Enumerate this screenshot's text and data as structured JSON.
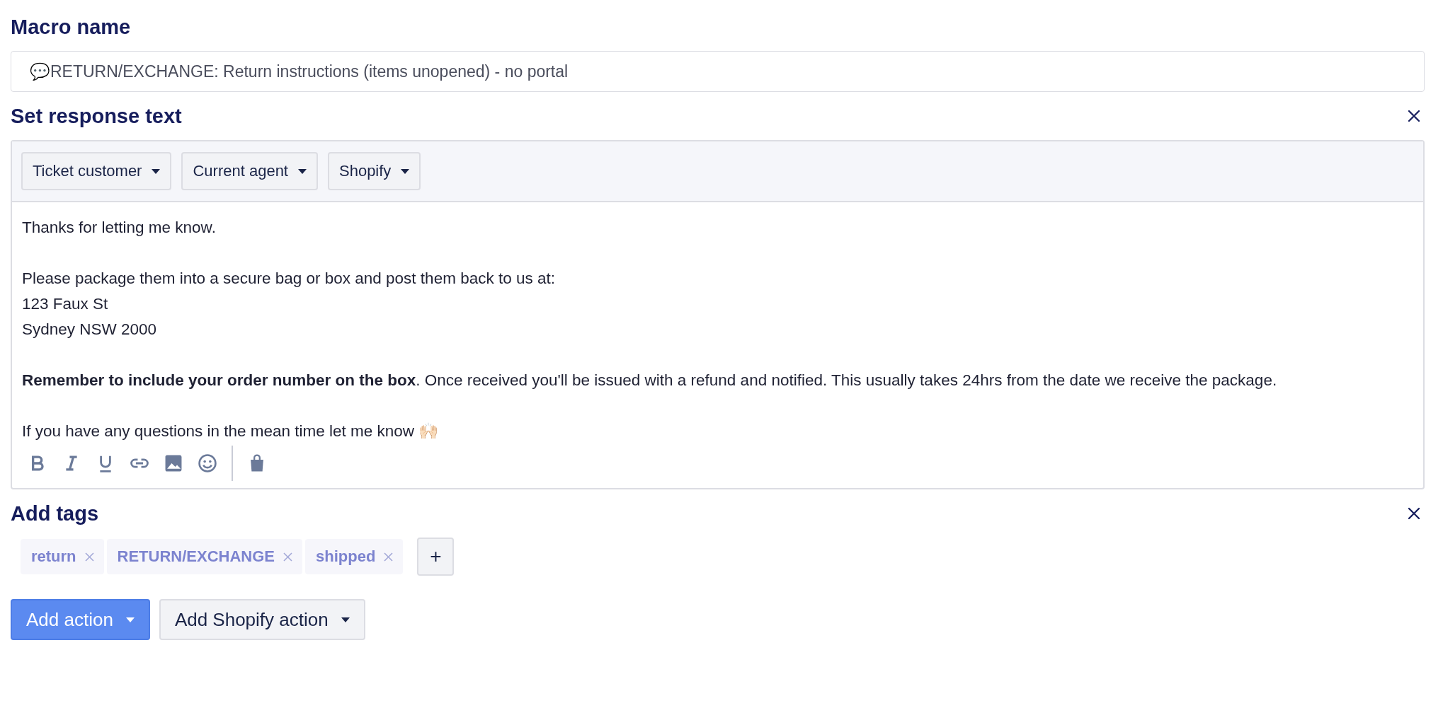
{
  "macro_name": {
    "label": "Macro name",
    "value": "💬RETURN/EXCHANGE: Return instructions (items unopened) - no portal"
  },
  "response_text": {
    "label": "Set response text",
    "variable_menus": [
      "Ticket customer",
      "Current agent",
      "Shopify"
    ],
    "paragraphs": [
      [
        "Thanks for letting me know."
      ],
      [
        "Please package them into a secure bag or box and post them back to us at:",
        "123 Faux St",
        "Sydney NSW 2000"
      ],
      [
        "**Remember to include your order number on the box**. Once received you'll be issued with a refund and notified. This usually takes 24hrs from the date we receive the package."
      ],
      [
        "If you have any questions in the mean time let me know 🙌🏻"
      ]
    ]
  },
  "tags": {
    "label": "Add tags",
    "items": [
      "return",
      "RETURN/EXCHANGE",
      "shipped"
    ],
    "add_button": "+"
  },
  "buttons": [
    {
      "label": "Add action",
      "kind": "primary"
    },
    {
      "label": "Add Shopify action",
      "kind": "secondary"
    }
  ]
}
